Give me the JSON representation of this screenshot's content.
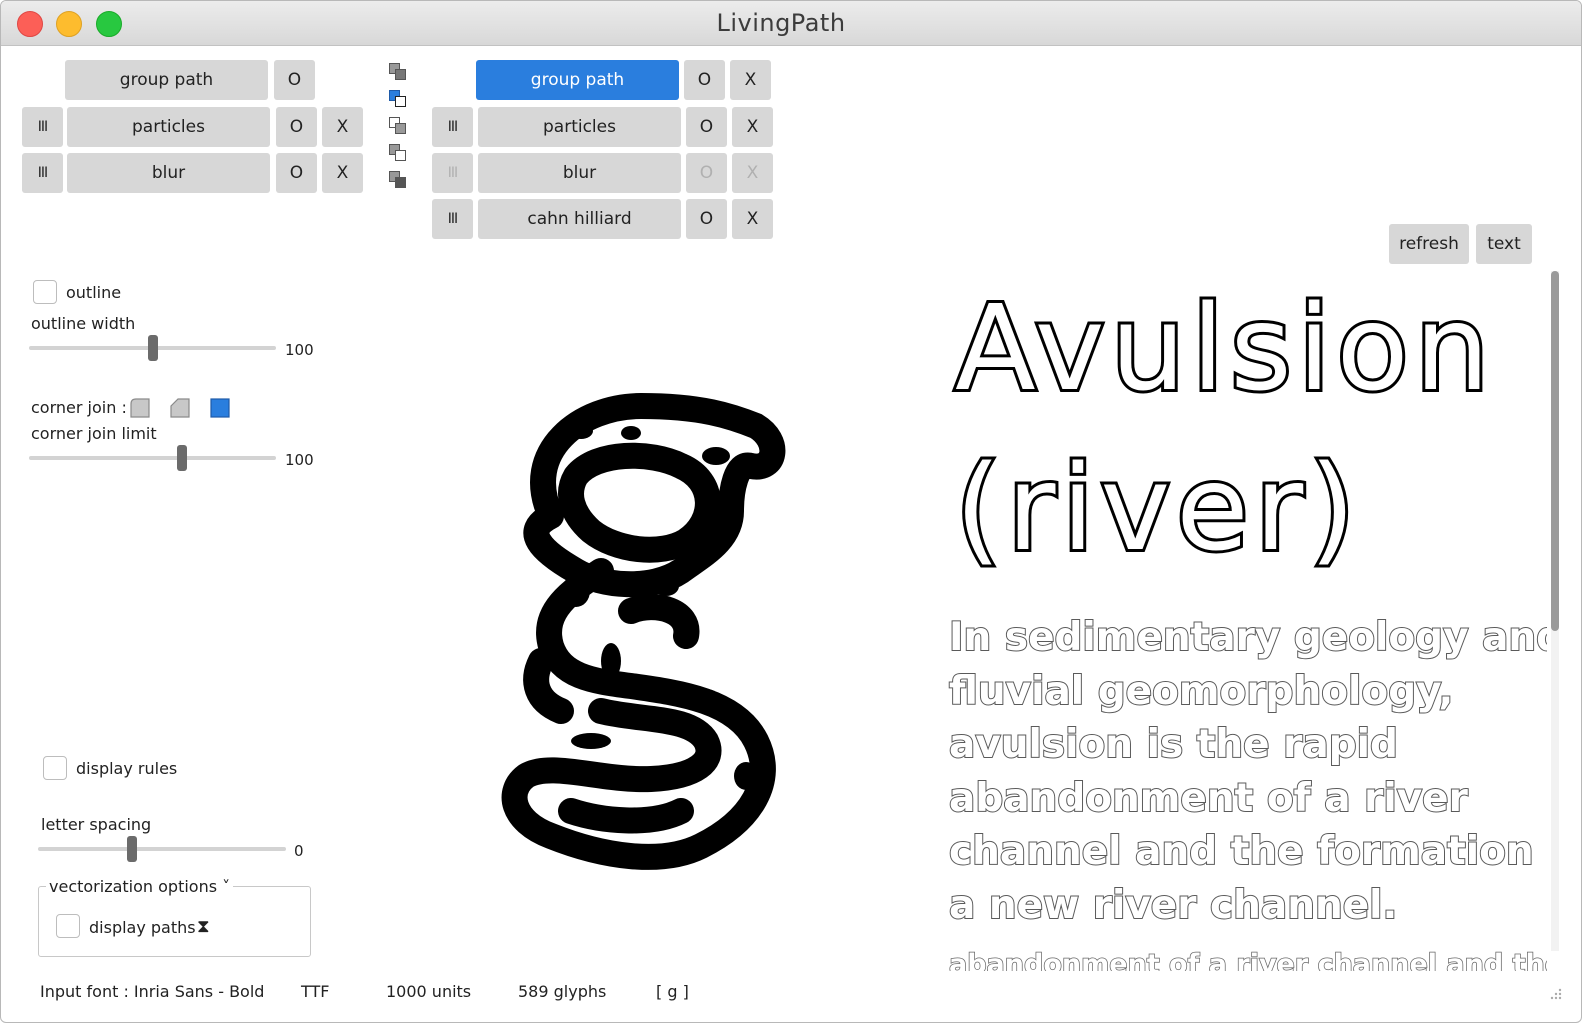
{
  "window": {
    "title": "LivingPath"
  },
  "pipeline_left": {
    "group_label": "group path",
    "rows": [
      {
        "handle": "III",
        "label": "particles",
        "toggle": "O",
        "remove": "X"
      },
      {
        "handle": "III",
        "label": "blur",
        "toggle": "O",
        "remove": "X"
      }
    ],
    "group_toggle": "O"
  },
  "pipeline_right": {
    "group_label": "group path",
    "group_toggle": "O",
    "group_remove": "X",
    "rows": [
      {
        "handle": "III",
        "label": "particles",
        "toggle": "O",
        "remove": "X"
      },
      {
        "handle": "III",
        "label": "blur",
        "toggle": "O",
        "remove": "X"
      },
      {
        "handle": "III",
        "label": "cahn hilliard",
        "toggle": "O",
        "remove": "X"
      }
    ]
  },
  "layer_modes": [
    "layer-stack",
    "layer-selected",
    "layer-outer",
    "layer-inner",
    "layer-merge"
  ],
  "top_right_buttons": {
    "refresh": "refresh",
    "text": "text"
  },
  "settings": {
    "outline_label": "outline",
    "outline_width_label": "outline width",
    "outline_width_value": "100",
    "outline_width_level": 0.5,
    "corner_join_label": "corner join :",
    "corner_join_limit_label": "corner join limit",
    "corner_join_limit_value": "100",
    "corner_join_limit_level": 0.62,
    "display_rules_label": "display rules",
    "letter_spacing_label": "letter spacing",
    "letter_spacing_value": "0",
    "letter_spacing_level": 0.38,
    "vectorization_label": "vectorization options ˅",
    "display_paths_label": "display paths",
    "hourglass_icon": "⧗"
  },
  "preview": {
    "title_line1": "Avulsion",
    "title_line2": "(river)",
    "body_lines": [
      "In sedimentary geology and",
      "fluvial geomorphology,",
      "avulsion is the rapid",
      "abandonment of a river",
      "channel and the formation of",
      "a new river channel."
    ],
    "cut_line": "abandonment of a river channel and the"
  },
  "status_bar": {
    "font_label": "Input font :  Inria Sans - Bold",
    "format": "TTF",
    "units": "1000 units",
    "glyphs": "589 glyphs",
    "current_glyph": "[ g ]"
  },
  "colors": {
    "accent": "#2a7ede",
    "button_bg": "#d7d7d7"
  }
}
